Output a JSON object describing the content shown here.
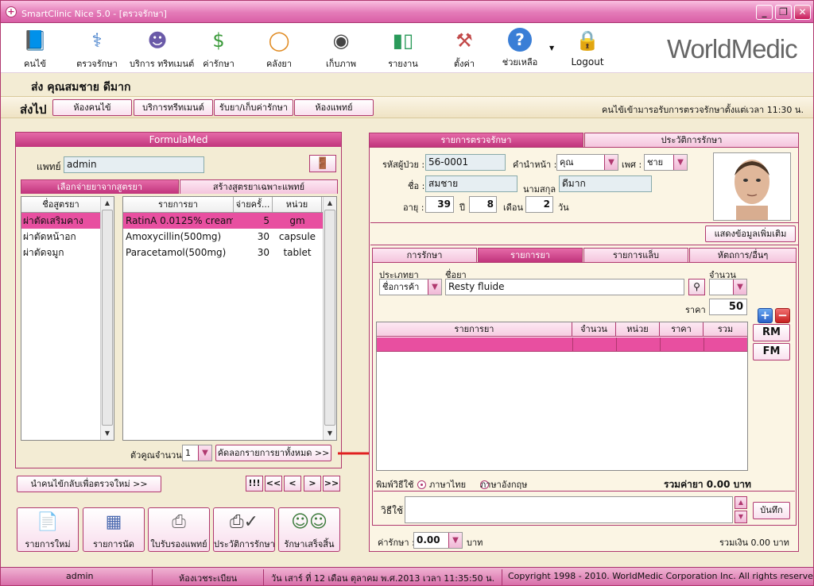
{
  "window": {
    "title": "SmartClinic Nice 5.0 - [ตรวจรักษา]",
    "app_icon": "plus-icon",
    "controls": [
      "_",
      "❐",
      "✕"
    ]
  },
  "toolbar": {
    "items": [
      {
        "label": "คนไข้",
        "icon": "patient-book-icon"
      },
      {
        "label": "ตรวจรักษา",
        "icon": "doctor-icon"
      },
      {
        "label": "บริการ ทริทเมนต์",
        "icon": "masks-icon"
      },
      {
        "label": "ค่ารักษา",
        "icon": "money-icon"
      },
      {
        "label": "คลังยา",
        "icon": "pill-icon"
      },
      {
        "label": "เก็บภาพ",
        "icon": "camera-icon"
      },
      {
        "label": "รายงาน",
        "icon": "bar-chart-icon"
      },
      {
        "label": "ตั้งค่า",
        "icon": "tools-icon"
      },
      {
        "label": "ช่วยเหลือ",
        "icon": "help-icon"
      },
      {
        "label": "Logout",
        "icon": "lock-icon"
      }
    ],
    "brand": "WorldMedic"
  },
  "patient_header": {
    "text": "ส่ง  คุณสมชาย ดีมาก"
  },
  "send_to": {
    "label": "ส่งไป",
    "buttons": [
      "ห้องคนไข้",
      "บริการทรีทเมนต์",
      "รับยา/เก็บค่ารักษา",
      "ห้องแพทย์"
    ],
    "status_text": "คนไข้เข้ามารอรับการตรวจรักษาตั้งแต่เวลา  11:30 น."
  },
  "formula": {
    "title": "FormulaMed",
    "doctor_label": "แพทย์",
    "doctor_value": "admin",
    "tabs": [
      "เลือกจ่ายยาจากสูตรยา",
      "สร้างสูตรยาเฉพาะแพทย์"
    ],
    "formula_list": {
      "header": "ชื่อสูตรยา",
      "rows": [
        "ผ่าตัดเสริมคาง",
        "ผ่าตัดหน้าอก",
        "ผ่าตัดจมูก"
      ]
    },
    "drug_grid": {
      "headers": [
        "รายการยา",
        "จ่ายครั้...",
        "หน่วย"
      ],
      "rows": [
        [
          "RatinA 0.0125% cream",
          "5",
          "gm"
        ],
        [
          "Amoxycillin(500mg)",
          "30",
          "capsule"
        ],
        [
          "Paracetamol(500mg)",
          "30",
          "tablet"
        ]
      ]
    },
    "multiplier_label": "ตัวคูณจำนวน",
    "multiplier_value": "1",
    "copy_all_button": "คัดลอกรายการยาทั้งหมด >>"
  },
  "left_bottom": {
    "back_button": "นำคนไข้กลับเพื่อตรวจใหม่ >>",
    "nav_buttons": [
      "!!!",
      "<<",
      "<",
      ">",
      ">>"
    ],
    "actions": [
      {
        "label": "รายการใหม่",
        "icon": "document-icon"
      },
      {
        "label": "รายการนัด",
        "icon": "calendar-icon"
      },
      {
        "label": "ใบรับรองแพทย์",
        "icon": "printer-icon"
      },
      {
        "label": "ประวัติการรักษา",
        "icon": "printer-check-icon"
      },
      {
        "label": "รักษาเสร็จสิ้น",
        "icon": "people-icon"
      }
    ]
  },
  "right": {
    "tabs": [
      "รายการตรวจรักษา",
      "ประวัติการรักษา"
    ],
    "patient": {
      "id_label": "รหัสผู้ป่วย :",
      "id_value": "56-0001",
      "prefix_label": "คำนำหน้า :",
      "prefix_value": "คุณ",
      "sex_label": "เพศ :",
      "sex_value": "ชาย",
      "name_label": "ชื่อ :",
      "name_value": "สมชาย",
      "surname_label": "นามสกุล :",
      "surname_value": "ดีมาก",
      "age_label": "อายุ :",
      "age_years": "39",
      "years_unit": "ปี",
      "age_months": "8",
      "months_unit": "เดือน",
      "age_days": "2",
      "days_unit": "วัน",
      "more_button": "แสดงข้อมูลเพิ่มเติม"
    },
    "sub_tabs": [
      "การรักษา",
      "รายการยา",
      "รายการแล็บ",
      "หัตถการ/อื่นๆ"
    ],
    "drug_entry": {
      "type_label": "ประเภทยา",
      "type_value": "ชื่อการค้า",
      "name_label": "ชื่อยา",
      "name_value": "Resty fluide",
      "qty_label": "จำนวน",
      "price_label": "ราคา",
      "price_value": "50"
    },
    "order_grid": {
      "headers": [
        "รายการยา",
        "จำนวน",
        "หน่วย",
        "ราคา",
        "รวม"
      ]
    },
    "side_buttons": [
      "RM",
      "FM"
    ],
    "print_label": "พิมพ์วิธีใช้",
    "lang_thai": "ภาษาไทย",
    "lang_eng": "ภาษาอังกฤษ",
    "drug_total": "รวมค่ายา 0.00 บาท",
    "usage_label": "วิธีใช้",
    "save_button": "บันทึก",
    "fee_label": "ค่ารักษา :",
    "fee_value": "0.00",
    "baht": "บาท",
    "grand_total": "รวมเงิน 0.00 บาท"
  },
  "statusbar": {
    "user": "admin",
    "room": "ห้องเวชระเบียน",
    "datetime": "วัน เสาร์ ที่ 12 เดือน ตุลาคม พ.ศ.2013 เวลา 11:35:50 น.",
    "copyright": "Copyright 1998 - 2010. WorldMedic Corporation Inc. All rights reserve"
  },
  "colors": {
    "accent": "#d4589c",
    "selected_row": "#e84fa0",
    "frame": "#b0386f",
    "arrow": "#e02020"
  }
}
